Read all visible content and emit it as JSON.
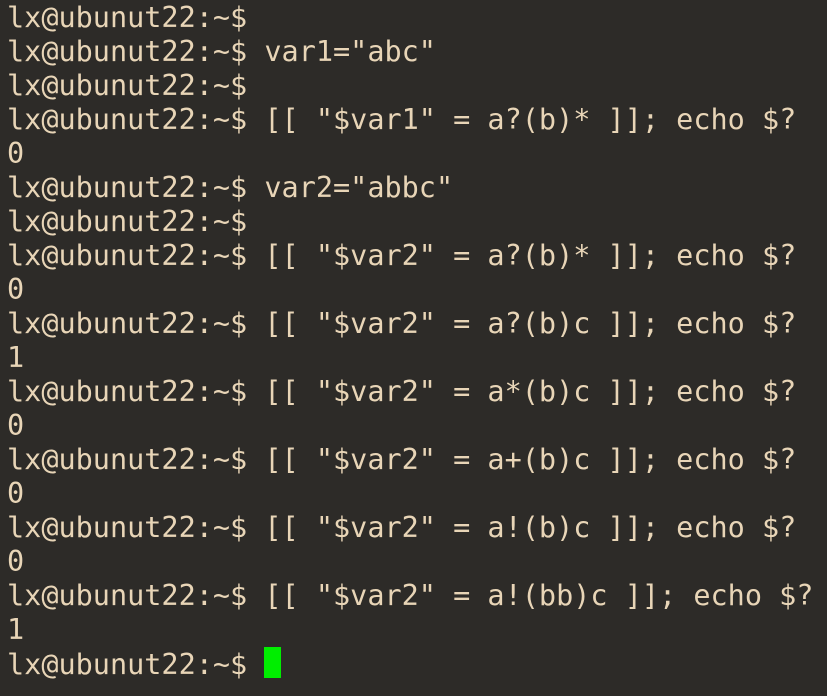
{
  "terminal": {
    "prompt": "lx@ubunut22:~$",
    "lines": [
      {
        "type": "prompt",
        "command": ""
      },
      {
        "type": "prompt",
        "command": "var1=\"abc\""
      },
      {
        "type": "prompt",
        "command": ""
      },
      {
        "type": "prompt",
        "command": "[[ \"$var1\" = a?(b)* ]]; echo $?"
      },
      {
        "type": "output",
        "text": "0"
      },
      {
        "type": "prompt",
        "command": "var2=\"abbc\""
      },
      {
        "type": "prompt",
        "command": ""
      },
      {
        "type": "prompt",
        "command": "[[ \"$var2\" = a?(b)* ]]; echo $?"
      },
      {
        "type": "output",
        "text": "0"
      },
      {
        "type": "prompt",
        "command": "[[ \"$var2\" = a?(b)c ]]; echo $?"
      },
      {
        "type": "output",
        "text": "1"
      },
      {
        "type": "prompt",
        "command": "[[ \"$var2\" = a*(b)c ]]; echo $?"
      },
      {
        "type": "output",
        "text": "0"
      },
      {
        "type": "prompt",
        "command": "[[ \"$var2\" = a+(b)c ]]; echo $?"
      },
      {
        "type": "output",
        "text": "0"
      },
      {
        "type": "prompt",
        "command": "[[ \"$var2\" = a!(b)c ]]; echo $?"
      },
      {
        "type": "output",
        "text": "0"
      },
      {
        "type": "prompt",
        "command": "[[ \"$var2\" = a!(bb)c ]]; echo $?"
      },
      {
        "type": "output",
        "text": "1"
      },
      {
        "type": "active",
        "command": ""
      }
    ],
    "colors": {
      "background": "#2d2b28",
      "foreground": "#e8d5b7",
      "cursor": "#00ee00"
    }
  }
}
